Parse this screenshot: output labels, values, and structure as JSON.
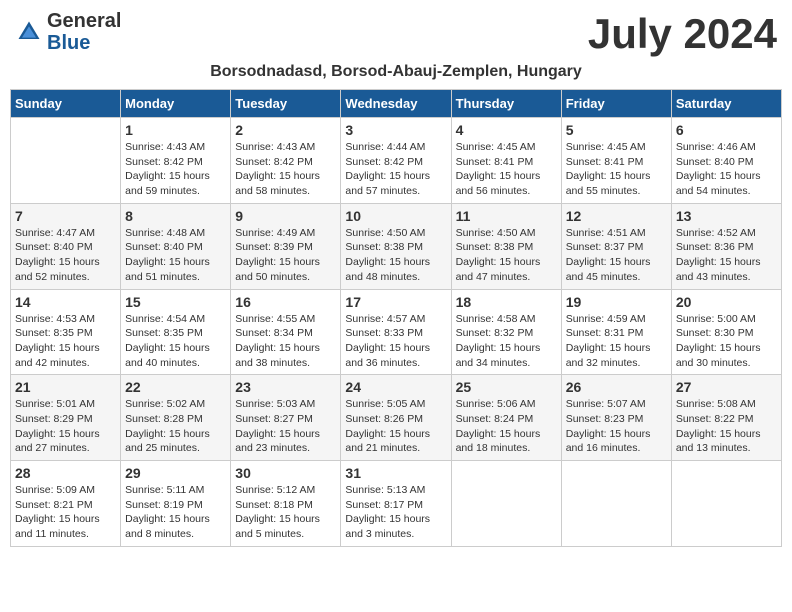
{
  "header": {
    "logo_general": "General",
    "logo_blue": "Blue",
    "month_title": "July 2024",
    "location": "Borsodnadasd, Borsod-Abauj-Zemplen, Hungary"
  },
  "days_of_week": [
    "Sunday",
    "Monday",
    "Tuesday",
    "Wednesday",
    "Thursday",
    "Friday",
    "Saturday"
  ],
  "weeks": [
    [
      {
        "day": "",
        "info": ""
      },
      {
        "day": "1",
        "info": "Sunrise: 4:43 AM\nSunset: 8:42 PM\nDaylight: 15 hours\nand 59 minutes."
      },
      {
        "day": "2",
        "info": "Sunrise: 4:43 AM\nSunset: 8:42 PM\nDaylight: 15 hours\nand 58 minutes."
      },
      {
        "day": "3",
        "info": "Sunrise: 4:44 AM\nSunset: 8:42 PM\nDaylight: 15 hours\nand 57 minutes."
      },
      {
        "day": "4",
        "info": "Sunrise: 4:45 AM\nSunset: 8:41 PM\nDaylight: 15 hours\nand 56 minutes."
      },
      {
        "day": "5",
        "info": "Sunrise: 4:45 AM\nSunset: 8:41 PM\nDaylight: 15 hours\nand 55 minutes."
      },
      {
        "day": "6",
        "info": "Sunrise: 4:46 AM\nSunset: 8:40 PM\nDaylight: 15 hours\nand 54 minutes."
      }
    ],
    [
      {
        "day": "7",
        "info": "Sunrise: 4:47 AM\nSunset: 8:40 PM\nDaylight: 15 hours\nand 52 minutes."
      },
      {
        "day": "8",
        "info": "Sunrise: 4:48 AM\nSunset: 8:40 PM\nDaylight: 15 hours\nand 51 minutes."
      },
      {
        "day": "9",
        "info": "Sunrise: 4:49 AM\nSunset: 8:39 PM\nDaylight: 15 hours\nand 50 minutes."
      },
      {
        "day": "10",
        "info": "Sunrise: 4:50 AM\nSunset: 8:38 PM\nDaylight: 15 hours\nand 48 minutes."
      },
      {
        "day": "11",
        "info": "Sunrise: 4:50 AM\nSunset: 8:38 PM\nDaylight: 15 hours\nand 47 minutes."
      },
      {
        "day": "12",
        "info": "Sunrise: 4:51 AM\nSunset: 8:37 PM\nDaylight: 15 hours\nand 45 minutes."
      },
      {
        "day": "13",
        "info": "Sunrise: 4:52 AM\nSunset: 8:36 PM\nDaylight: 15 hours\nand 43 minutes."
      }
    ],
    [
      {
        "day": "14",
        "info": "Sunrise: 4:53 AM\nSunset: 8:35 PM\nDaylight: 15 hours\nand 42 minutes."
      },
      {
        "day": "15",
        "info": "Sunrise: 4:54 AM\nSunset: 8:35 PM\nDaylight: 15 hours\nand 40 minutes."
      },
      {
        "day": "16",
        "info": "Sunrise: 4:55 AM\nSunset: 8:34 PM\nDaylight: 15 hours\nand 38 minutes."
      },
      {
        "day": "17",
        "info": "Sunrise: 4:57 AM\nSunset: 8:33 PM\nDaylight: 15 hours\nand 36 minutes."
      },
      {
        "day": "18",
        "info": "Sunrise: 4:58 AM\nSunset: 8:32 PM\nDaylight: 15 hours\nand 34 minutes."
      },
      {
        "day": "19",
        "info": "Sunrise: 4:59 AM\nSunset: 8:31 PM\nDaylight: 15 hours\nand 32 minutes."
      },
      {
        "day": "20",
        "info": "Sunrise: 5:00 AM\nSunset: 8:30 PM\nDaylight: 15 hours\nand 30 minutes."
      }
    ],
    [
      {
        "day": "21",
        "info": "Sunrise: 5:01 AM\nSunset: 8:29 PM\nDaylight: 15 hours\nand 27 minutes."
      },
      {
        "day": "22",
        "info": "Sunrise: 5:02 AM\nSunset: 8:28 PM\nDaylight: 15 hours\nand 25 minutes."
      },
      {
        "day": "23",
        "info": "Sunrise: 5:03 AM\nSunset: 8:27 PM\nDaylight: 15 hours\nand 23 minutes."
      },
      {
        "day": "24",
        "info": "Sunrise: 5:05 AM\nSunset: 8:26 PM\nDaylight: 15 hours\nand 21 minutes."
      },
      {
        "day": "25",
        "info": "Sunrise: 5:06 AM\nSunset: 8:24 PM\nDaylight: 15 hours\nand 18 minutes."
      },
      {
        "day": "26",
        "info": "Sunrise: 5:07 AM\nSunset: 8:23 PM\nDaylight: 15 hours\nand 16 minutes."
      },
      {
        "day": "27",
        "info": "Sunrise: 5:08 AM\nSunset: 8:22 PM\nDaylight: 15 hours\nand 13 minutes."
      }
    ],
    [
      {
        "day": "28",
        "info": "Sunrise: 5:09 AM\nSunset: 8:21 PM\nDaylight: 15 hours\nand 11 minutes."
      },
      {
        "day": "29",
        "info": "Sunrise: 5:11 AM\nSunset: 8:19 PM\nDaylight: 15 hours\nand 8 minutes."
      },
      {
        "day": "30",
        "info": "Sunrise: 5:12 AM\nSunset: 8:18 PM\nDaylight: 15 hours\nand 5 minutes."
      },
      {
        "day": "31",
        "info": "Sunrise: 5:13 AM\nSunset: 8:17 PM\nDaylight: 15 hours\nand 3 minutes."
      },
      {
        "day": "",
        "info": ""
      },
      {
        "day": "",
        "info": ""
      },
      {
        "day": "",
        "info": ""
      }
    ]
  ]
}
